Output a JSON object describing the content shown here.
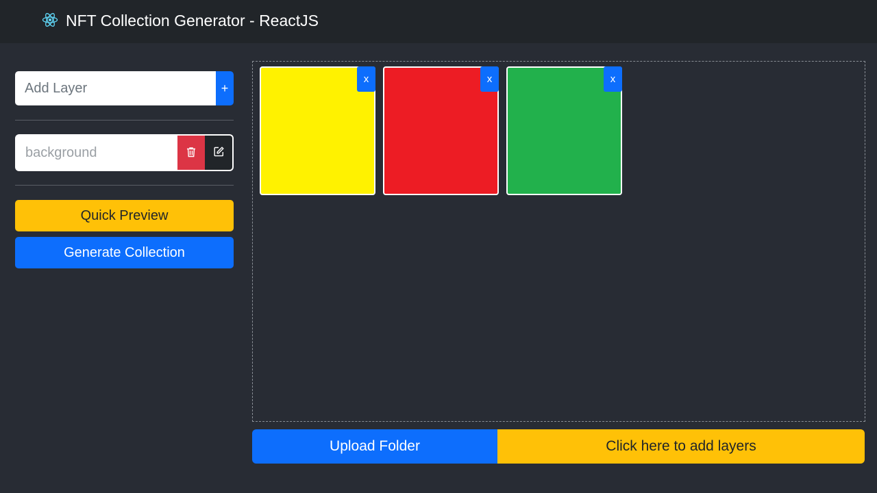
{
  "header": {
    "title": "NFT Collection Generator - ReactJS",
    "icon": "react-atom-icon",
    "icon_color": "#61dafb"
  },
  "sidebar": {
    "add_layer": {
      "placeholder": "Add Layer",
      "value": "",
      "button_label": "+"
    },
    "layers": [
      {
        "name": "background",
        "delete_icon": "trash-icon",
        "edit_icon": "edit-icon"
      }
    ],
    "quick_preview_label": "Quick Preview",
    "generate_label": "Generate Collection"
  },
  "main": {
    "images": [
      {
        "color": "#fff200",
        "remove_label": "x"
      },
      {
        "color": "#ed1c24",
        "remove_label": "x"
      },
      {
        "color": "#22b14c",
        "remove_label": "x"
      }
    ],
    "upload_label": "Upload Folder",
    "add_layers_label": "Click here to add layers"
  },
  "colors": {
    "primary": "#0d6efd",
    "warning": "#ffc107",
    "danger": "#dc3545",
    "background": "#282c34",
    "navbar": "#212529"
  }
}
